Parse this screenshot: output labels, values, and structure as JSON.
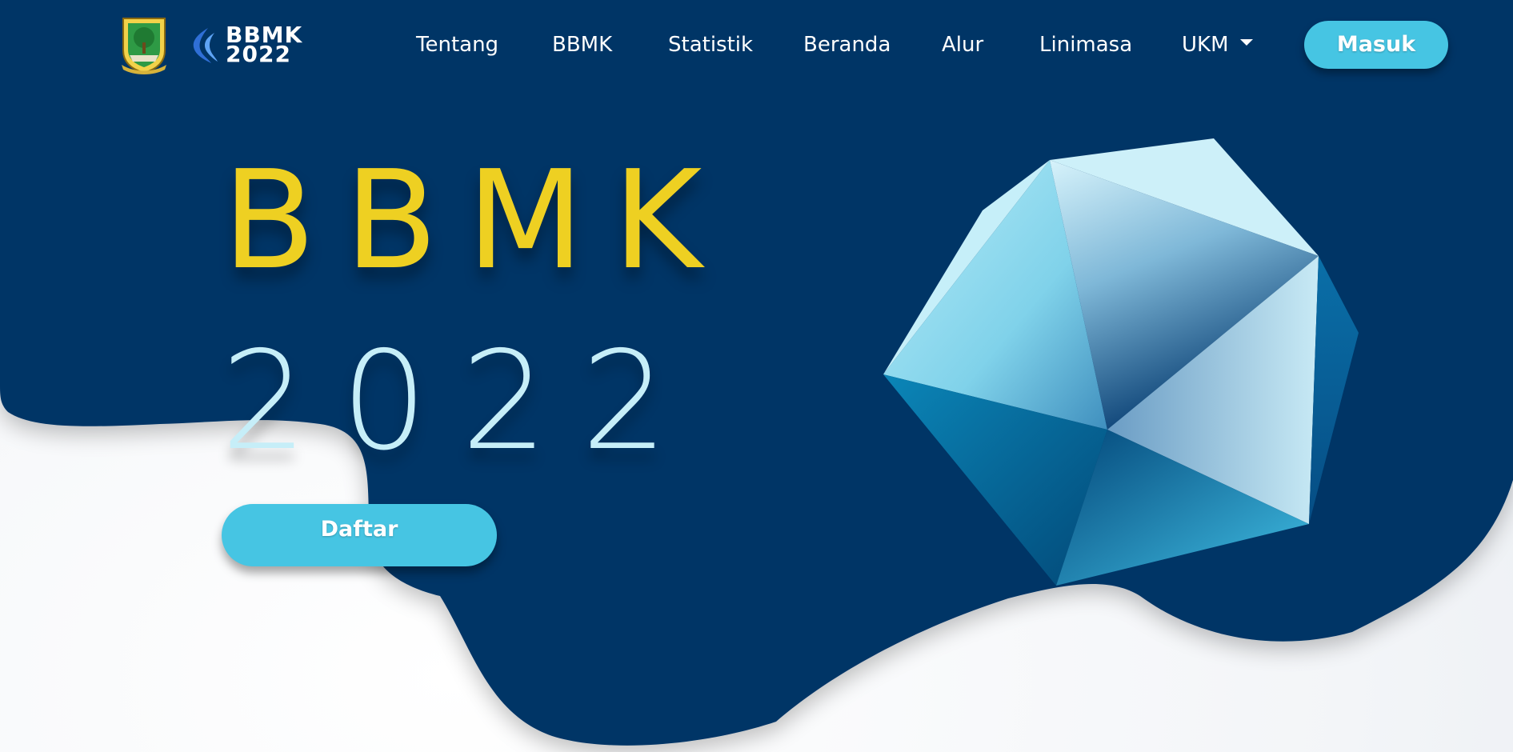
{
  "brand": {
    "line1": "BBMK",
    "line2": "2022",
    "seal_icon": "regional-seal-icon",
    "mark_icon": "flame-mark-icon"
  },
  "nav": {
    "items": [
      {
        "label": "Tentang"
      },
      {
        "label": "BBMK"
      },
      {
        "label": "Statistik"
      },
      {
        "label": "Beranda"
      },
      {
        "label": "Alur"
      },
      {
        "label": "Linimasa"
      },
      {
        "label": "UKM"
      }
    ],
    "login_label": "Masuk"
  },
  "hero": {
    "title": "BBMK",
    "year": "2022",
    "register_label": "Daftar",
    "illustration_icon": "crystal-polyhedron-icon"
  },
  "colors": {
    "navy": "#013466",
    "accent": "#46c5e3",
    "title_yellow": "#eed022",
    "year_light_blue": "#c6eef8"
  }
}
